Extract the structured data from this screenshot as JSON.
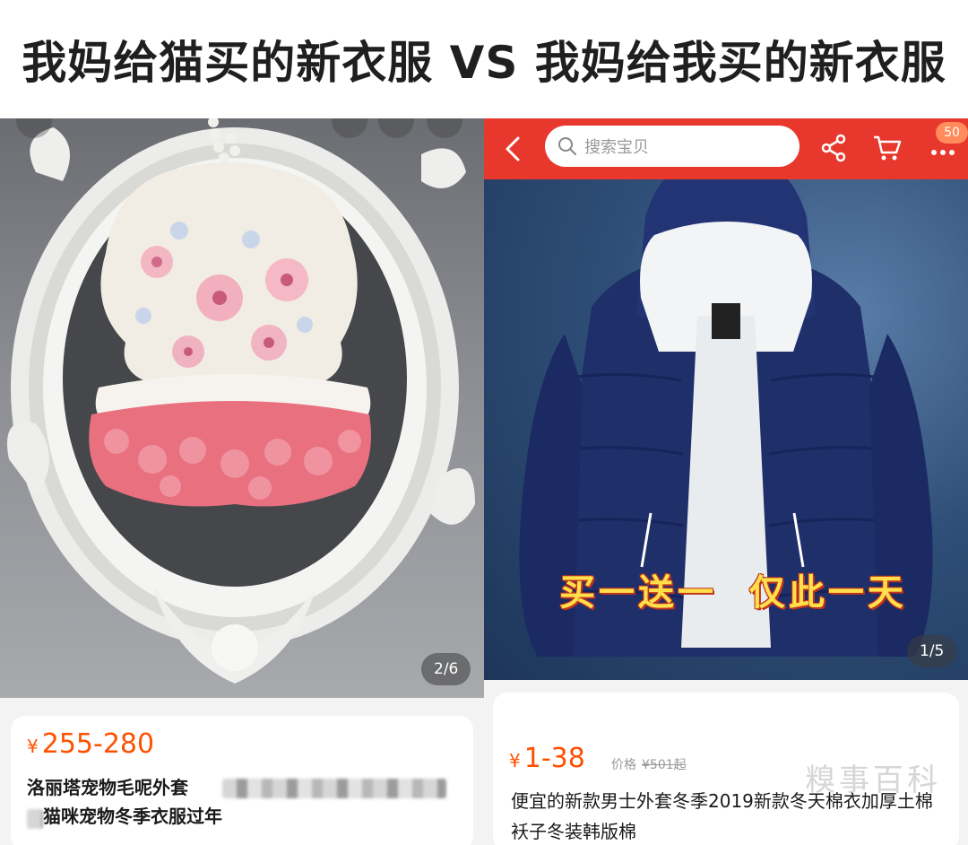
{
  "headline": "我妈给猫买的新衣服 VS 我妈给我买的新衣服",
  "left": {
    "image_counter": "2/6",
    "price_symbol": "¥",
    "price": "255-280",
    "title_line1": "洛丽塔宠物毛呢外套",
    "title_line2": "猫咪宠物冬季衣服过年"
  },
  "right": {
    "search_placeholder": "搜索宝贝",
    "cart_badge": "50",
    "promo_text": "买一送一  仅此一天",
    "image_counter": "1/5",
    "price_symbol": "¥",
    "price": "1-38",
    "orig_label": "价格",
    "orig_price": "¥501起",
    "title": "便宜的新款男士外套冬季2019新款冬天棉衣加厚土棉袄子冬装韩版棉"
  },
  "watermark": "糗事百科",
  "colors": {
    "accent_red": "#e8372c",
    "price_orange": "#ff5000",
    "promo_yellow": "#ffe04a"
  },
  "icons": [
    "back-arrow-icon",
    "search-icon",
    "share-icon",
    "cart-icon",
    "more-dots-icon"
  ]
}
